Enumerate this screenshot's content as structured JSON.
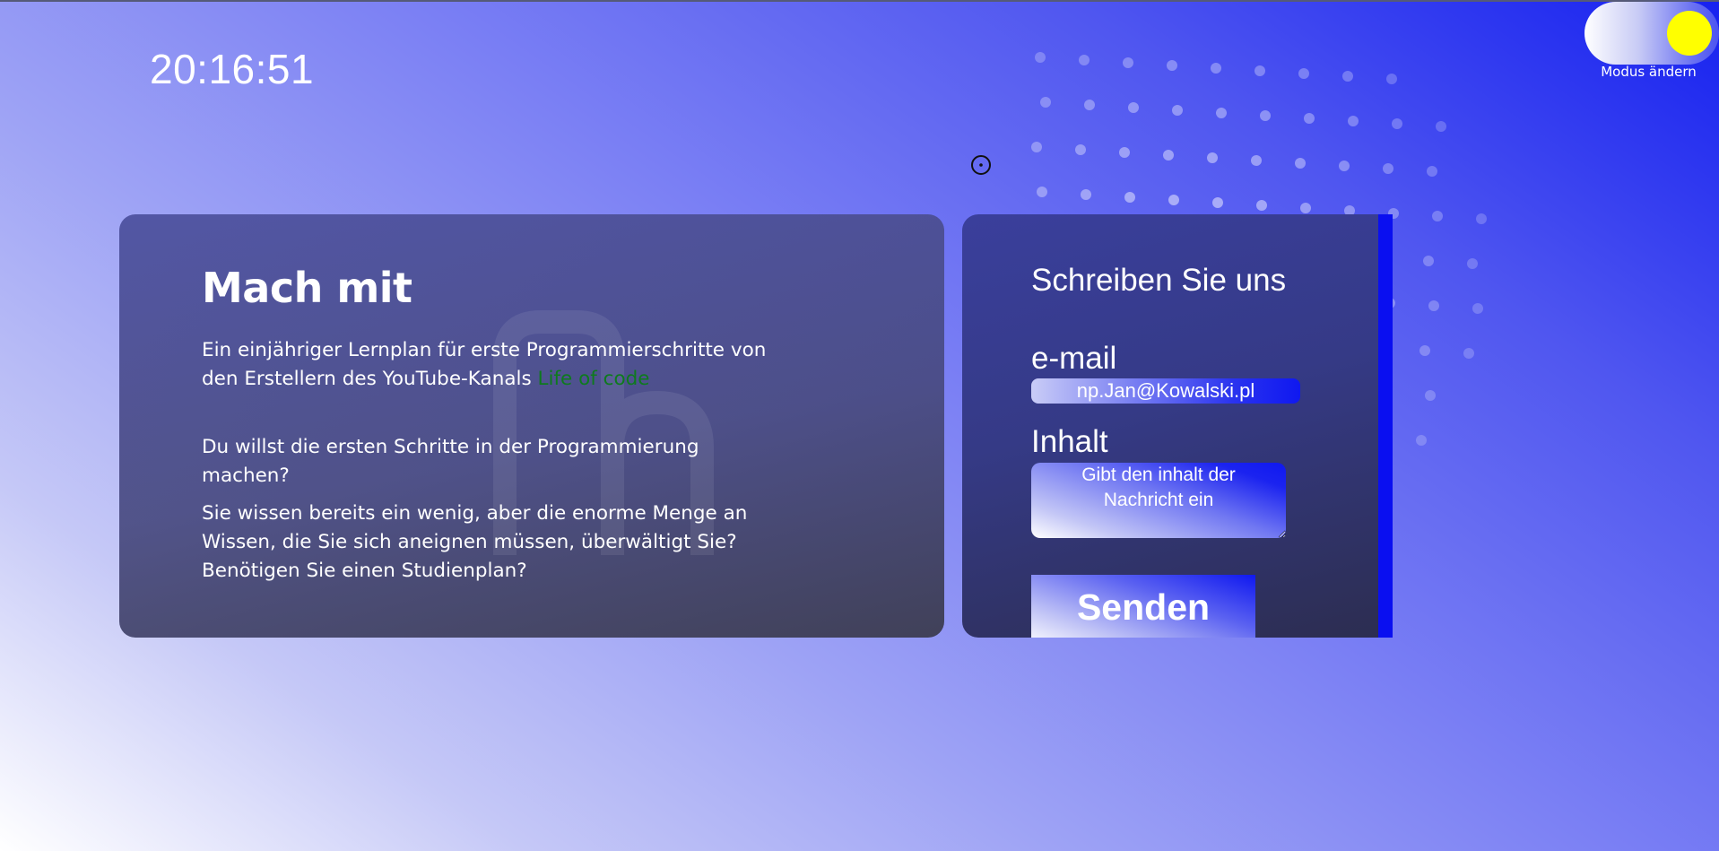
{
  "clock": {
    "time": "20:16:51"
  },
  "mode_toggle": {
    "label": "Modus ändern",
    "knob_color": "#ffff00"
  },
  "join_section": {
    "title": "Mach mit",
    "paragraph1_text": "Ein einjähriger Lernplan für erste Programmierschritte von den Erstellern des YouTube-Kanals ",
    "paragraph1_link": "Life of code",
    "paragraph2": "Du willst die ersten Schritte in der Programmierung machen?",
    "paragraph3": "Sie wissen bereits ein wenig, aber die enorme Menge an Wissen, die Sie sich aneignen müssen, überwältigt Sie? Benötigen Sie einen Studienplan?"
  },
  "contact_form": {
    "title": "Schreiben Sie uns",
    "email_label": "e-mail",
    "email_placeholder": "np.Jan@Kowalski.pl",
    "message_label": "Inhalt",
    "message_placeholder": "Gibt den inhalt der Nachricht ein",
    "send_label": "Senden"
  },
  "colors": {
    "link": "#0e7a1e",
    "accent_blue": "#0f18f0",
    "toggle_knob": "#ffff00"
  },
  "icons": [
    "target-cursor-icon",
    "dots-pattern",
    "toggle-knob"
  ]
}
